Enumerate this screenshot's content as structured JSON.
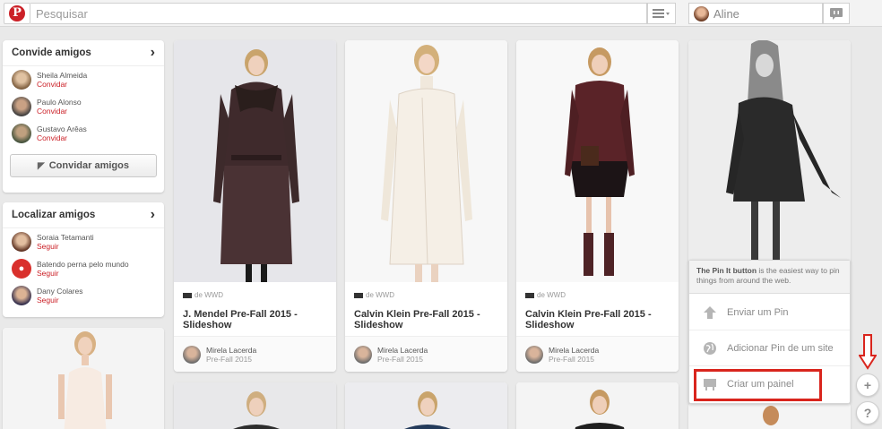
{
  "header": {
    "search_placeholder": "Pesquisar",
    "user_name": "Aline"
  },
  "invite_module": {
    "title": "Convide amigos",
    "people": [
      {
        "name": "Sheila Almeida",
        "action": "Convidar"
      },
      {
        "name": "Paulo Alonso",
        "action": "Convidar"
      },
      {
        "name": "Gustavo Arêas",
        "action": "Convidar"
      }
    ],
    "button_label": "Convidar amigos"
  },
  "find_module": {
    "title": "Localizar amigos",
    "people": [
      {
        "name": "Soraia Tetamanti",
        "action": "Seguir"
      },
      {
        "name": "Batendo perna pelo mundo",
        "action": "Seguir"
      },
      {
        "name": "Dany Colares",
        "action": "Seguir"
      }
    ]
  },
  "pins": [
    {
      "source": "de WWD",
      "title": "J. Mendel Pre-Fall 2015 - Slideshow",
      "pinner": "Mirela Lacerda",
      "board": "Pre-Fall 2015"
    },
    {
      "source": "de WWD",
      "title": "Calvin Klein Pre-Fall 2015 - Slideshow",
      "pinner": "Mirela Lacerda",
      "board": "Pre-Fall 2015"
    },
    {
      "source": "de WWD",
      "title": "Calvin Klein Pre-Fall 2015 - Slideshow",
      "pinner": "Mirela Lacerda",
      "board": "Pre-Fall 2015"
    }
  ],
  "popup": {
    "tip_bold": "The Pin It button",
    "tip_text": " is the easiest way to pin things from around the web.",
    "items": [
      {
        "label": "Enviar um Pin",
        "icon": "upload-arrow-icon"
      },
      {
        "label": "Adicionar Pin de um site",
        "icon": "globe-icon"
      },
      {
        "label": "Criar um painel",
        "icon": "board-icon"
      }
    ]
  },
  "side_buttons": {
    "add": "+",
    "help": "?"
  },
  "colors": {
    "brand": "#cb2027",
    "highlight": "#d9251d"
  }
}
